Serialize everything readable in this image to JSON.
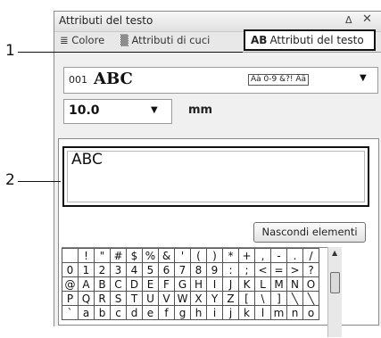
{
  "panel": {
    "title": "Attributi del testo",
    "pin_glyph": "Δ",
    "close_glyph": "✕"
  },
  "tabs": [
    {
      "icon": "≣",
      "label": "Colore"
    },
    {
      "icon": "▒",
      "label": "Attributi di cuci"
    },
    {
      "icon": "AB",
      "label": "Attributi del testo"
    }
  ],
  "font": {
    "number": "001",
    "name": "ABC",
    "charsets": "Aà 0-9 &?! Ää"
  },
  "size": {
    "value": "10.0",
    "unit": "mm"
  },
  "text_input": {
    "value": "ABC"
  },
  "hide_button": {
    "label": "Nascondi elementi"
  },
  "char_grid": {
    "rows": [
      [
        "",
        "!",
        "\"",
        "#",
        "$",
        "%",
        "&",
        "'",
        "(",
        ")",
        "*",
        "+",
        ",",
        "-",
        ".",
        "/"
      ],
      [
        "0",
        "1",
        "2",
        "3",
        "4",
        "5",
        "6",
        "7",
        "8",
        "9",
        ":",
        ";",
        "<",
        "=",
        ">",
        "?"
      ],
      [
        "@",
        "A",
        "B",
        "C",
        "D",
        "E",
        "F",
        "G",
        "H",
        "I",
        "J",
        "K",
        "L",
        "M",
        "N",
        "O"
      ],
      [
        "P",
        "Q",
        "R",
        "S",
        "T",
        "U",
        "V",
        "W",
        "X",
        "Y",
        "Z",
        "[",
        "\\",
        "]",
        "╲",
        "╲"
      ],
      [
        "`",
        "a",
        "b",
        "c",
        "d",
        "e",
        "f",
        "g",
        "h",
        "i",
        "j",
        "k",
        "l",
        "m",
        "n",
        "o"
      ]
    ]
  },
  "callouts": [
    {
      "label": "1"
    },
    {
      "label": "2"
    }
  ]
}
